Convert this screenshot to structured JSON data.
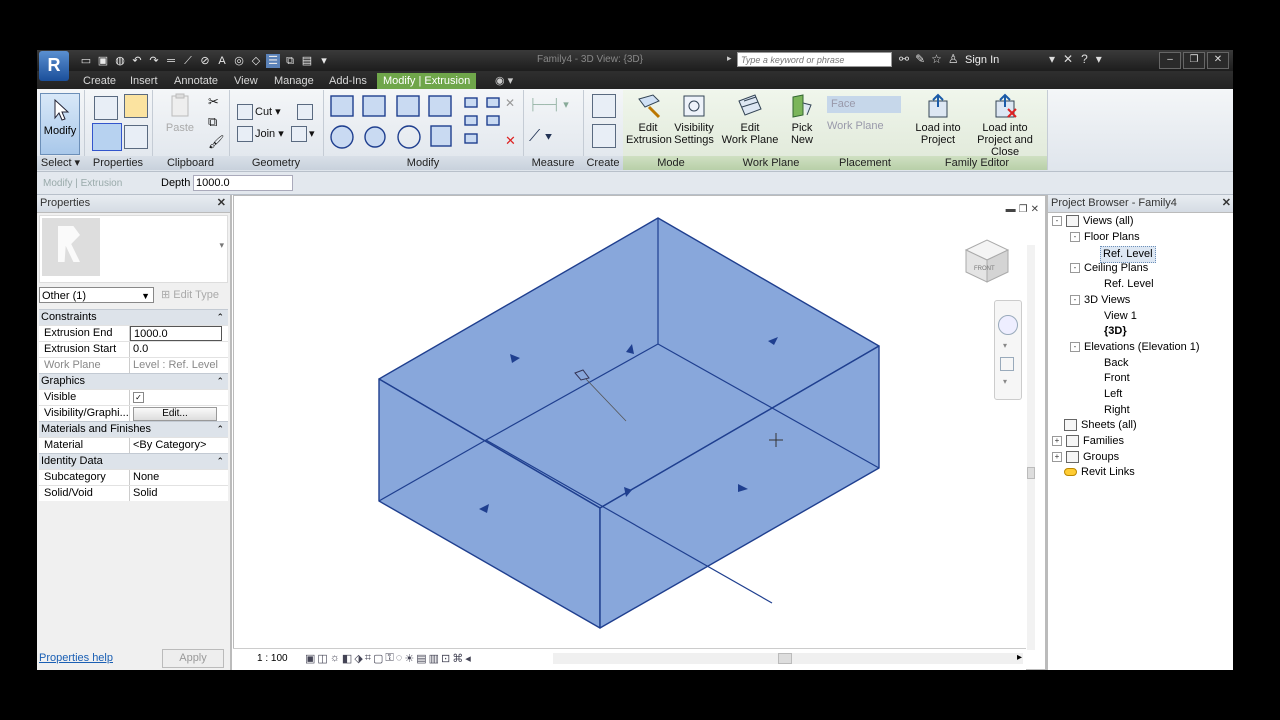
{
  "app_button": "R",
  "title": {
    "document": "Family4 - 3D View: {3D}",
    "search_placeholder": "Type a keyword or phrase",
    "sign_in": "Sign In"
  },
  "tabs": [
    "Create",
    "Insert",
    "Annotate",
    "View",
    "Manage",
    "Add-Ins",
    "Modify | Extrusion"
  ],
  "ribbon": {
    "panels": [
      "Select",
      "Properties",
      "Clipboard",
      "Geometry",
      "Modify",
      "Measure",
      "Create",
      "Mode",
      "Work Plane",
      "Placement",
      "Family Editor"
    ],
    "modify": "Modify",
    "select": "Select",
    "paste": "Paste",
    "cut": "Cut",
    "join": "Join",
    "edit_extrusion": [
      "Edit",
      "Extrusion"
    ],
    "visibility_settings": [
      "Visibility",
      "Settings"
    ],
    "edit_work_plane": [
      "Edit",
      "Work Plane"
    ],
    "pick_new": [
      "Pick",
      "New"
    ],
    "face": "Face",
    "work_plane_btn": "Work Plane",
    "load_into_project": [
      "Load into",
      "Project"
    ],
    "load_into_project_close": [
      "Load into",
      "Project and Close"
    ]
  },
  "options_bar": {
    "context": "Modify | Extrusion",
    "depth_label": "Depth",
    "depth_value": "1000.0"
  },
  "properties": {
    "header": "Properties",
    "instance": "Other (1)",
    "edit_type": "Edit Type",
    "groups": [
      {
        "name": "Constraints",
        "rows": [
          {
            "k": "Extrusion End",
            "v": "1000.0",
            "edit": true
          },
          {
            "k": "Extrusion Start",
            "v": "0.0"
          },
          {
            "k": "Work Plane",
            "v": "Level : Ref. Level",
            "dim": true
          }
        ]
      },
      {
        "name": "Graphics",
        "rows": [
          {
            "k": "Visible",
            "v": "✓",
            "check": true
          },
          {
            "k": "Visibility/Graphi...",
            "v": "Edit...",
            "button": true
          }
        ]
      },
      {
        "name": "Materials and Finishes",
        "rows": [
          {
            "k": "Material",
            "v": "<By Category>"
          }
        ]
      },
      {
        "name": "Identity Data",
        "rows": [
          {
            "k": "Subcategory",
            "v": "None"
          },
          {
            "k": "Solid/Void",
            "v": "Solid"
          }
        ]
      }
    ],
    "help_link": "Properties help",
    "apply": "Apply"
  },
  "view": {
    "scale": "1 : 100",
    "viewcube_label": "FRONT",
    "face_color": "#7e9fd8",
    "edge_color": "#1f3f8f"
  },
  "project_browser": {
    "header": "Project Browser - Family4",
    "items": [
      {
        "label": "Views (all)",
        "level": 0,
        "toggle": "-",
        "icon": true
      },
      {
        "label": "Floor Plans",
        "level": 1,
        "toggle": "-"
      },
      {
        "label": "Ref. Level",
        "level": 2,
        "selected": true
      },
      {
        "label": "Ceiling Plans",
        "level": 1,
        "toggle": "-"
      },
      {
        "label": "Ref. Level",
        "level": 2
      },
      {
        "label": "3D Views",
        "level": 1,
        "toggle": "-"
      },
      {
        "label": "View 1",
        "level": 2
      },
      {
        "label": "{3D}",
        "level": 2,
        "bold": true
      },
      {
        "label": "Elevations (Elevation 1)",
        "level": 1,
        "toggle": "-"
      },
      {
        "label": "Back",
        "level": 2
      },
      {
        "label": "Front",
        "level": 2
      },
      {
        "label": "Left",
        "level": 2
      },
      {
        "label": "Right",
        "level": 2
      },
      {
        "label": "Sheets (all)",
        "level": 0,
        "icon": true
      },
      {
        "label": "Families",
        "level": 0,
        "toggle": "+",
        "icon": true
      },
      {
        "label": "Groups",
        "level": 0,
        "toggle": "+",
        "icon": true
      },
      {
        "label": "Revit Links",
        "level": 0,
        "icon": true
      }
    ]
  }
}
